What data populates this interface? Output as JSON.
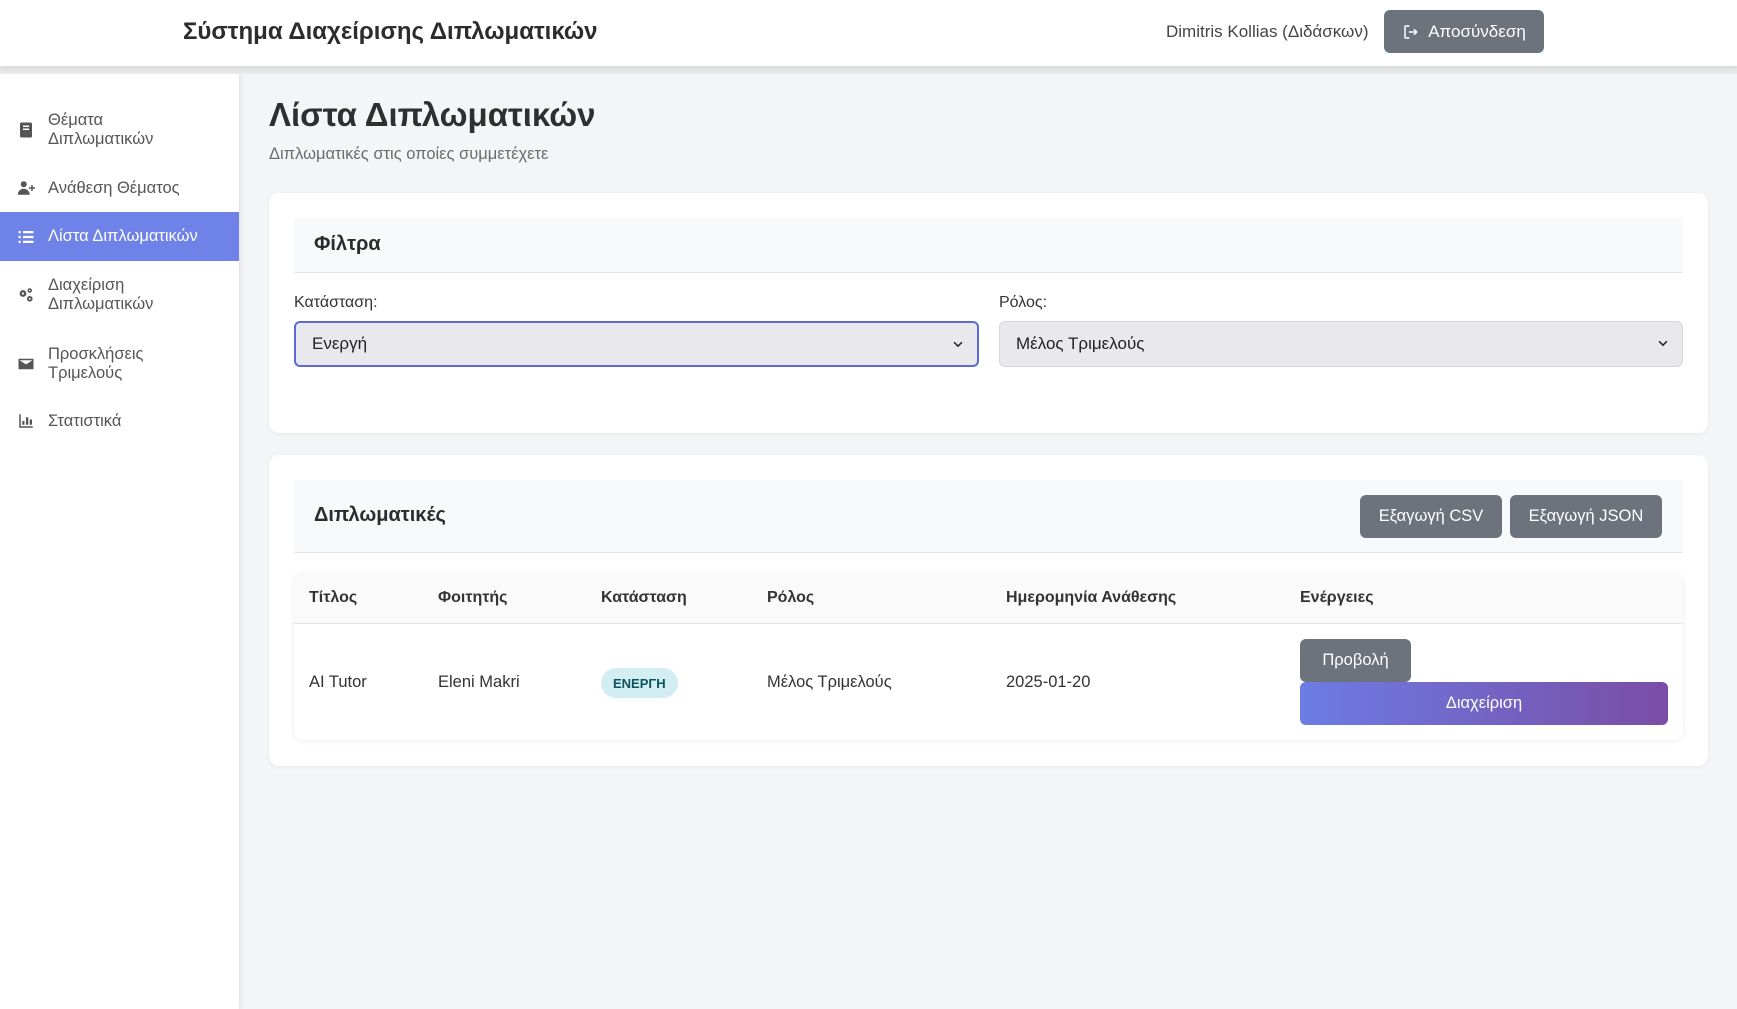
{
  "header": {
    "app_title": "Σύστημα Διαχείρισης Διπλωματικών",
    "user_name": "Dimitris Kollias (Διδάσκων)",
    "logout_label": "Αποσύνδεση"
  },
  "sidebar": {
    "items": [
      {
        "label": "Θέματα Διπλωματικών",
        "icon": "book-icon",
        "active": false
      },
      {
        "label": "Ανάθεση Θέματος",
        "icon": "user-plus-icon",
        "active": false
      },
      {
        "label": "Λίστα Διπλωματικών",
        "icon": "list-icon",
        "active": true
      },
      {
        "label": "Διαχείριση Διπλωματικών",
        "icon": "cogs-icon",
        "active": false
      },
      {
        "label": "Προσκλήσεις Τριμελούς",
        "icon": "envelope-icon",
        "active": false
      },
      {
        "label": "Στατιστικά",
        "icon": "chart-icon",
        "active": false
      }
    ]
  },
  "main": {
    "title": "Λίστα Διπλωματικών",
    "subtitle": "Διπλωματικές στις οποίες συμμετέχετε",
    "filters": {
      "title": "Φίλτρα",
      "status_label": "Κατάσταση:",
      "status_value": "Ενεργή",
      "role_label": "Ρόλος:",
      "role_value": "Μέλος Τριμελούς"
    },
    "theses": {
      "title": "Διπλωματικές",
      "export_csv": "Εξαγωγή CSV",
      "export_json": "Εξαγωγή JSON",
      "columns": [
        "Τίτλος",
        "Φοιτητής",
        "Κατάσταση",
        "Ρόλος",
        "Ημερομηνία Ανάθεσης",
        "Ενέργειες"
      ],
      "rows": [
        {
          "title": "AI Tutor",
          "student": "Eleni Makri",
          "status": "ΕΝΕΡΓΗ",
          "role": "Μέλος Τριμελούς",
          "date": "2025-01-20",
          "view_label": "Προβολή",
          "manage_label": "Διαχείριση"
        }
      ]
    }
  },
  "colors": {
    "accent": "#6e82e8",
    "secondary_button": "#6c737d",
    "badge_bg": "#d3eef3",
    "badge_text": "#0c5460"
  }
}
